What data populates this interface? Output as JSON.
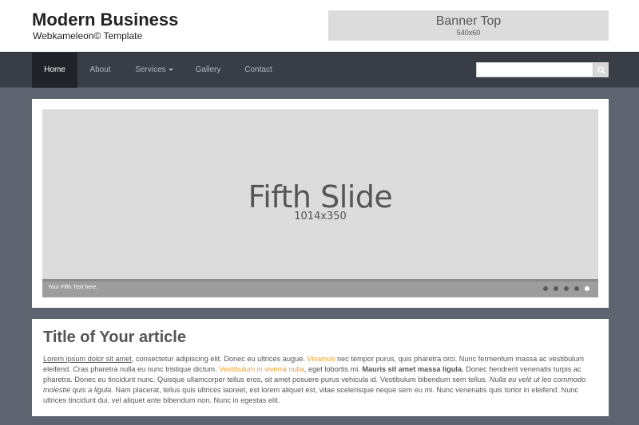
{
  "header": {
    "title": "Modern Business",
    "subtitle": "Webkameleon© Template",
    "banner_title": "Banner Top",
    "banner_size": "540x60"
  },
  "nav": {
    "items": [
      {
        "label": "Home",
        "active": true
      },
      {
        "label": "About"
      },
      {
        "label": "Services"
      },
      {
        "label": "Gallery"
      },
      {
        "label": "Contact"
      }
    ],
    "search_placeholder": "",
    "search_icon": "search-icon"
  },
  "slider": {
    "title": "Fifth Slide",
    "size": "1014x350",
    "caption": "Your Fifth Text here.",
    "slide_count": 5,
    "active_index": 5
  },
  "article": {
    "title": "Title of Your article",
    "p1": "Lorem ipsum dolor sit amet",
    "p2": ", consectetur adipiscing elit. Donec eu ultrices augue. ",
    "p3": "Vivamus",
    "p4": " nec tempor purus, quis pharetra orci. Nunc fermentum massa ac vestibulum eleifend. Cras pharetra nulla eu nunc tristique dictum. ",
    "p5": "Vestibulum in viverra nulla",
    "p6": ", eget lobortis mi. ",
    "p7": "Mauris sit amet massa ligula.",
    "p8": " Donec hendrerit venenatis turpis ac pharetra. Donec eu tincidunt nunc. Quisque ullamcorper tellus eros, sit amet posuere purus vehicula id. Vestibulum bibendum sem tellus. ",
    "p9": "Nulla eu velit ut leo commodo molestie quis a ligula.",
    "p10": " Nam placerat, tellus quis ultrices laoreet, est lorem aliquet est, vitae scelerisque neque sem eu mi. Nunc venenatis quis tortor in eleifend. Nunc ultrices tincidunt dui, vel aliquet ante bibendum non. Nunc in egestas elit."
  },
  "colors": {
    "page_bg": "#5d6470",
    "navbar_bg": "#383d46",
    "link_accent": "#f0a030"
  }
}
